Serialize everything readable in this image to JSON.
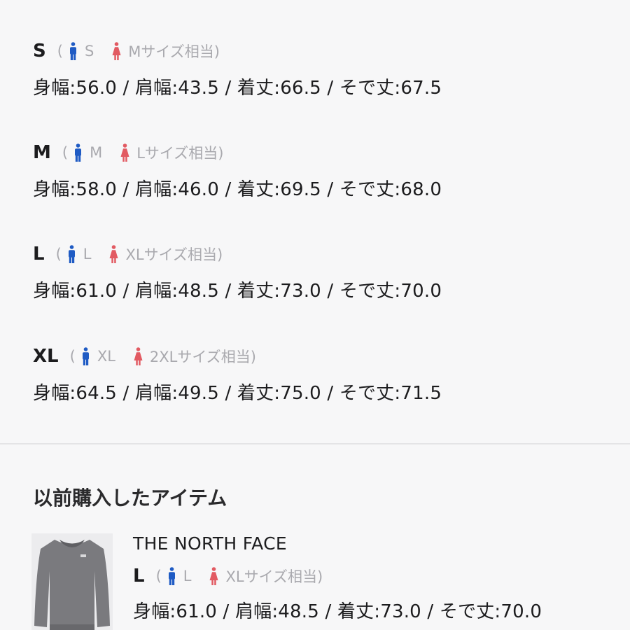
{
  "colors": {
    "men_icon": "#1f5bc4",
    "women_icon": "#e25a62",
    "text": "#1c1c1e",
    "muted": "#a9a9ae"
  },
  "icons": {
    "men": "man-figure-icon",
    "women": "woman-figure-icon"
  },
  "sizes": [
    {
      "name": "S",
      "open": "(",
      "men": "S",
      "women": "Mサイズ相当)",
      "measurements": "身幅:56.0 / 肩幅:43.5 / 着丈:66.5 / そで丈:67.5"
    },
    {
      "name": "M",
      "open": "(",
      "men": "M",
      "women": "Lサイズ相当)",
      "measurements": "身幅:58.0 / 肩幅:46.0 / 着丈:69.5 / そで丈:68.0"
    },
    {
      "name": "L",
      "open": "(",
      "men": "L",
      "women": "XLサイズ相当)",
      "measurements": "身幅:61.0 / 肩幅:48.5 / 着丈:73.0 / そで丈:70.0"
    },
    {
      "name": "XL",
      "open": "(",
      "men": "XL",
      "women": "2XLサイズ相当)",
      "measurements": "身幅:64.5 / 肩幅:49.5 / 着丈:75.0 / そで丈:71.5"
    }
  ],
  "previous": {
    "title": "以前購入したアイテム",
    "brand": "THE NORTH FACE",
    "size": {
      "name": "L",
      "open": "(",
      "men": "L",
      "women": "XLサイズ相当)",
      "measurements": "身幅:61.0 / 肩幅:48.5 / 着丈:73.0 / そで丈:70.0"
    }
  }
}
